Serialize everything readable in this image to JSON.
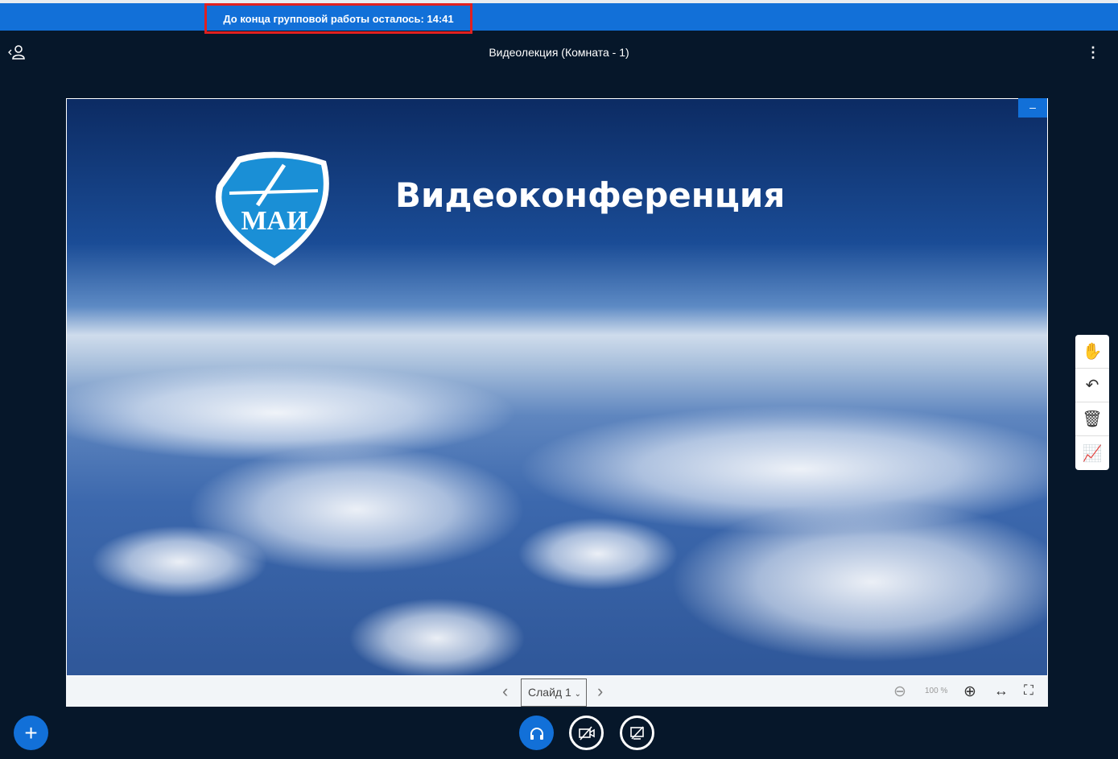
{
  "notice": {
    "text": "До конца групповой работы осталось: 14:41"
  },
  "header": {
    "title": "Видеолекция (Комната - 1)",
    "user_icon": "‹👤",
    "more_icon": "⋮"
  },
  "slide": {
    "title": "Видеоконференция",
    "logo_text": "МАИ",
    "minimize": "–"
  },
  "presentation_bar": {
    "prev": "‹",
    "slide_label": "Слайд 1",
    "next": "›",
    "zoom_out": "⊖",
    "zoom": "100 %",
    "zoom_in": "⊕",
    "fit_width": "↔",
    "fullscreen": "⛶"
  },
  "tools": {
    "hand": "✋",
    "undo": "↶",
    "clear": "🗑",
    "multi": "📈"
  },
  "actions": {
    "add": "+",
    "audio": "🎧",
    "video": "⊘",
    "screen": "▭"
  },
  "colors": {
    "accent": "#1270d8",
    "background": "#06172a",
    "highlight": "#e02020"
  }
}
